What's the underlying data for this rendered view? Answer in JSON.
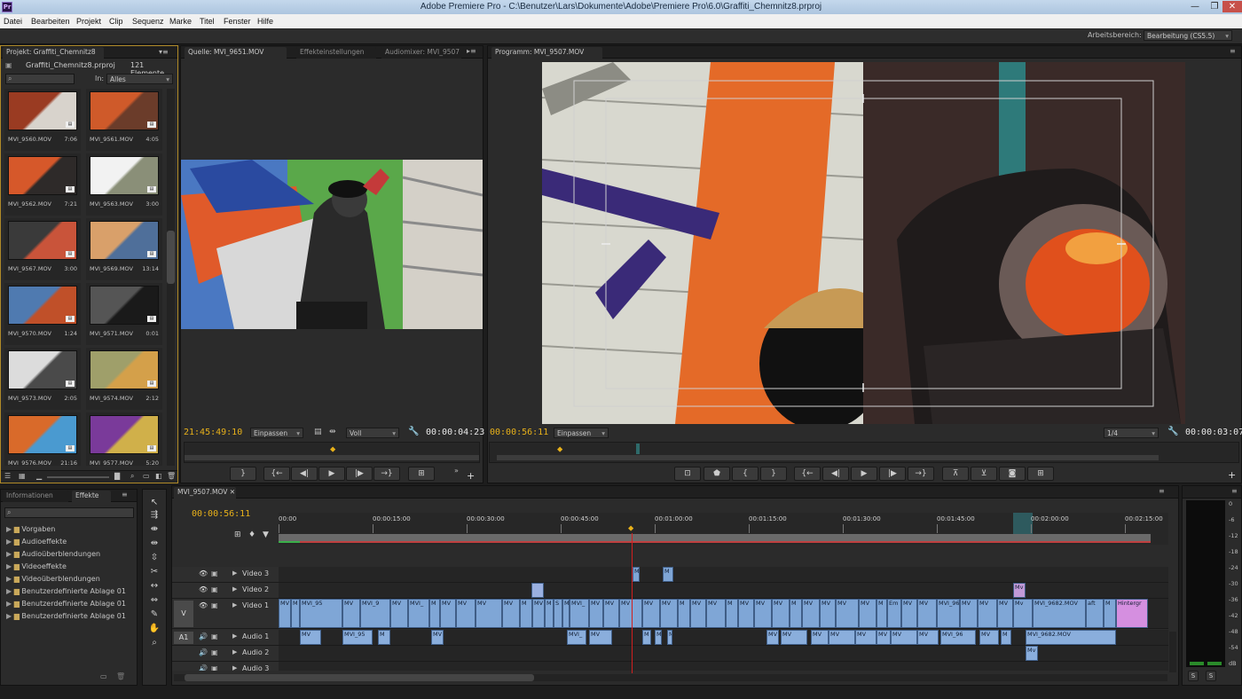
{
  "window": {
    "title": "Adobe Premiere Pro - C:\\Benutzer\\Lars\\Dokumente\\Adobe\\Premiere Pro\\6.0\\Graffiti_Chemnitz8.prproj",
    "app_icon": "Pr"
  },
  "menu": [
    "Datei",
    "Bearbeiten",
    "Projekt",
    "Clip",
    "Sequenz",
    "Marke",
    "Titel",
    "Fenster",
    "Hilfe"
  ],
  "workspace": {
    "label": "Arbeitsbereich:",
    "value": "Bearbeitung (CS5.5)"
  },
  "project": {
    "tab": "Projekt: Graffiti_Chemnitz8",
    "file": "Graffiti_Chemnitz8.prproj",
    "count": "121 Elemente",
    "in_label": "In:",
    "in_value": "Alles",
    "clips": [
      {
        "name": "MVI_9560.MOV",
        "dur": "7:06",
        "c1": "#9a3b22",
        "c2": "#d8d3cc"
      },
      {
        "name": "MVI_9561.MOV",
        "dur": "4:05",
        "c1": "#cf5a2a",
        "c2": "#6b3c2a"
      },
      {
        "name": "MVI_9562.MOV",
        "dur": "7:21",
        "c1": "#d6582a",
        "c2": "#2e2a29"
      },
      {
        "name": "MVI_9563.MOV",
        "dur": "3:00",
        "c1": "#f2f2f2",
        "c2": "#8a8f78"
      },
      {
        "name": "MVI_9567.MOV",
        "dur": "3:00",
        "c1": "#3a3a3a",
        "c2": "#c9543a"
      },
      {
        "name": "MVI_9569.MOV",
        "dur": "13:14",
        "c1": "#d9a06a",
        "c2": "#4f6f9a"
      },
      {
        "name": "MVI_9570.MOV",
        "dur": "1:24",
        "c1": "#4f7ab0",
        "c2": "#c05029"
      },
      {
        "name": "MVI_9571.MOV",
        "dur": "0:01",
        "c1": "#555555",
        "c2": "#1a1a1a"
      },
      {
        "name": "MVI_9573.MOV",
        "dur": "2:05",
        "c1": "#dcdcdc",
        "c2": "#4a4a4a"
      },
      {
        "name": "MVI_9574.MOV",
        "dur": "2:12",
        "c1": "#9f9f6a",
        "c2": "#d4a04a"
      },
      {
        "name": "MVI_9576.MOV",
        "dur": "21:16",
        "c1": "#d96a2a",
        "c2": "#4a9ad0"
      },
      {
        "name": "MVI_9577.MOV",
        "dur": "5:20",
        "c1": "#7a3a9a",
        "c2": "#d0b04a"
      }
    ]
  },
  "effects": {
    "tabs": [
      "Informationen",
      "Effekte"
    ],
    "items": [
      "Vorgaben",
      "Audioeffekte",
      "Audioüberblendungen",
      "Videoeffekte",
      "Videoüberblendungen",
      "Benutzerdefinierte Ablage 01",
      "Benutzerdefinierte Ablage 01",
      "Benutzerdefinierte Ablage 01"
    ]
  },
  "source": {
    "tabs": [
      "Quelle: MVI_9651.MOV",
      "Effekteinstellungen",
      "Audiomixer: MVI_9507"
    ],
    "timecode": "21:45:49:10",
    "fit": "Einpassen",
    "quality": "Voll",
    "duration": "00:00:04:23"
  },
  "program": {
    "tab": "Programm: MVI_9507.MOV",
    "timecode": "00:00:56:11",
    "fit": "Einpassen",
    "resolution": "1/4",
    "duration": "00:00:03:07"
  },
  "timeline": {
    "tab": "MVI_9507.MOV",
    "timecode": "00:00:56:11",
    "ruler": [
      "00:00",
      "00:00:15:00",
      "00:00:30:00",
      "00:00:45:00",
      "00:01:00:00",
      "00:01:15:00",
      "00:01:30:00",
      "00:01:45:00",
      "00:02:00:00",
      "00:02:15:00"
    ],
    "tracks": {
      "v3": "Video 3",
      "v2": "Video 2",
      "v1": "Video 1",
      "a1": "Audio 1",
      "a2": "Audio 2",
      "a3": "Audio 3",
      "v_target": "V",
      "a_target": "A1"
    },
    "clip_labels": {
      "c1": "M",
      "c2": "MV",
      "c3": "MVI_95",
      "c4": "MVI_9",
      "c5": "MV",
      "c6": "S",
      "c7": "MVI_",
      "c8": "Em",
      "c9": "MVI_96",
      "c10": "MVI_9682.MOV",
      "c11": "aft",
      "c12": "Hintergr",
      "c13": "MVI_95",
      "c14": "MVI_",
      "c15": "MVI_96",
      "c16": "MVI_9682.MOV",
      "c17": "MV",
      "c18": "M",
      "c19": "Mv",
      "c20": "Mv",
      "c21": "Mv",
      "c22": "M\\"
    }
  },
  "meter": {
    "scale": [
      "0",
      "-6",
      "-12",
      "-18",
      "-24",
      "-30",
      "-36",
      "-42",
      "-48",
      "-54",
      "dB"
    ],
    "solo": [
      "S",
      "S"
    ]
  },
  "colors": {
    "accent": "#e8b11a",
    "clip_video": "#7fa6d6",
    "clip_audio": "#8aaedc",
    "clip_pink": "#d58fe0",
    "playhead": "#d11f1f",
    "panel": "#2b2b2b"
  },
  "icons": [
    "search-icon",
    "play-icon",
    "step-back-icon",
    "step-forward-icon",
    "mark-in-icon",
    "mark-out-icon",
    "wrench-icon",
    "camera-icon",
    "folder-icon",
    "eye-icon",
    "speaker-icon",
    "selection-tool-icon",
    "razor-tool-icon",
    "hand-tool-icon",
    "zoom-tool-icon"
  ]
}
